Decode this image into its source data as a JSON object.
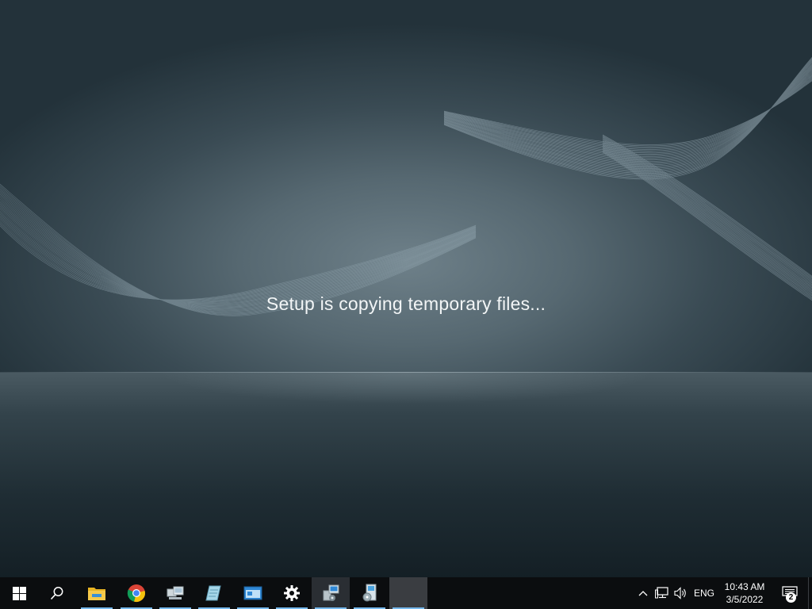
{
  "setup": {
    "message": "Setup is copying temporary files..."
  },
  "taskbar": {
    "start": {
      "icon": "windows-start-icon"
    },
    "search": {
      "icon": "search-icon"
    },
    "apps": [
      {
        "name": "file-explorer",
        "icon": "folder-icon",
        "running": true
      },
      {
        "name": "google-chrome",
        "icon": "chrome-icon",
        "running": true
      },
      {
        "name": "network-connections",
        "icon": "computers-icon",
        "running": true
      },
      {
        "name": "notepad-app",
        "icon": "notepad-icon",
        "running": true
      },
      {
        "name": "control-panel-app",
        "icon": "window-app-icon",
        "running": true
      },
      {
        "name": "settings",
        "icon": "gear-icon",
        "running": true
      },
      {
        "name": "setup-installer",
        "icon": "installer-icon",
        "running": true,
        "active": true
      },
      {
        "name": "disc-setup",
        "icon": "disc-setup-icon",
        "running": true
      },
      {
        "name": "blank-window",
        "icon": "blank-window",
        "running": true
      }
    ],
    "tray": {
      "chevron": "chevron-up-icon",
      "network": "network-icon",
      "volume": "volume-icon",
      "language": "ENG",
      "time": "10:43 AM",
      "date": "3/5/2022",
      "notifications_count": "2"
    }
  },
  "colors": {
    "taskbar_bg": "#0b0d0f",
    "running_indicator": "#76b9ed",
    "text": "#f2f5f6"
  }
}
